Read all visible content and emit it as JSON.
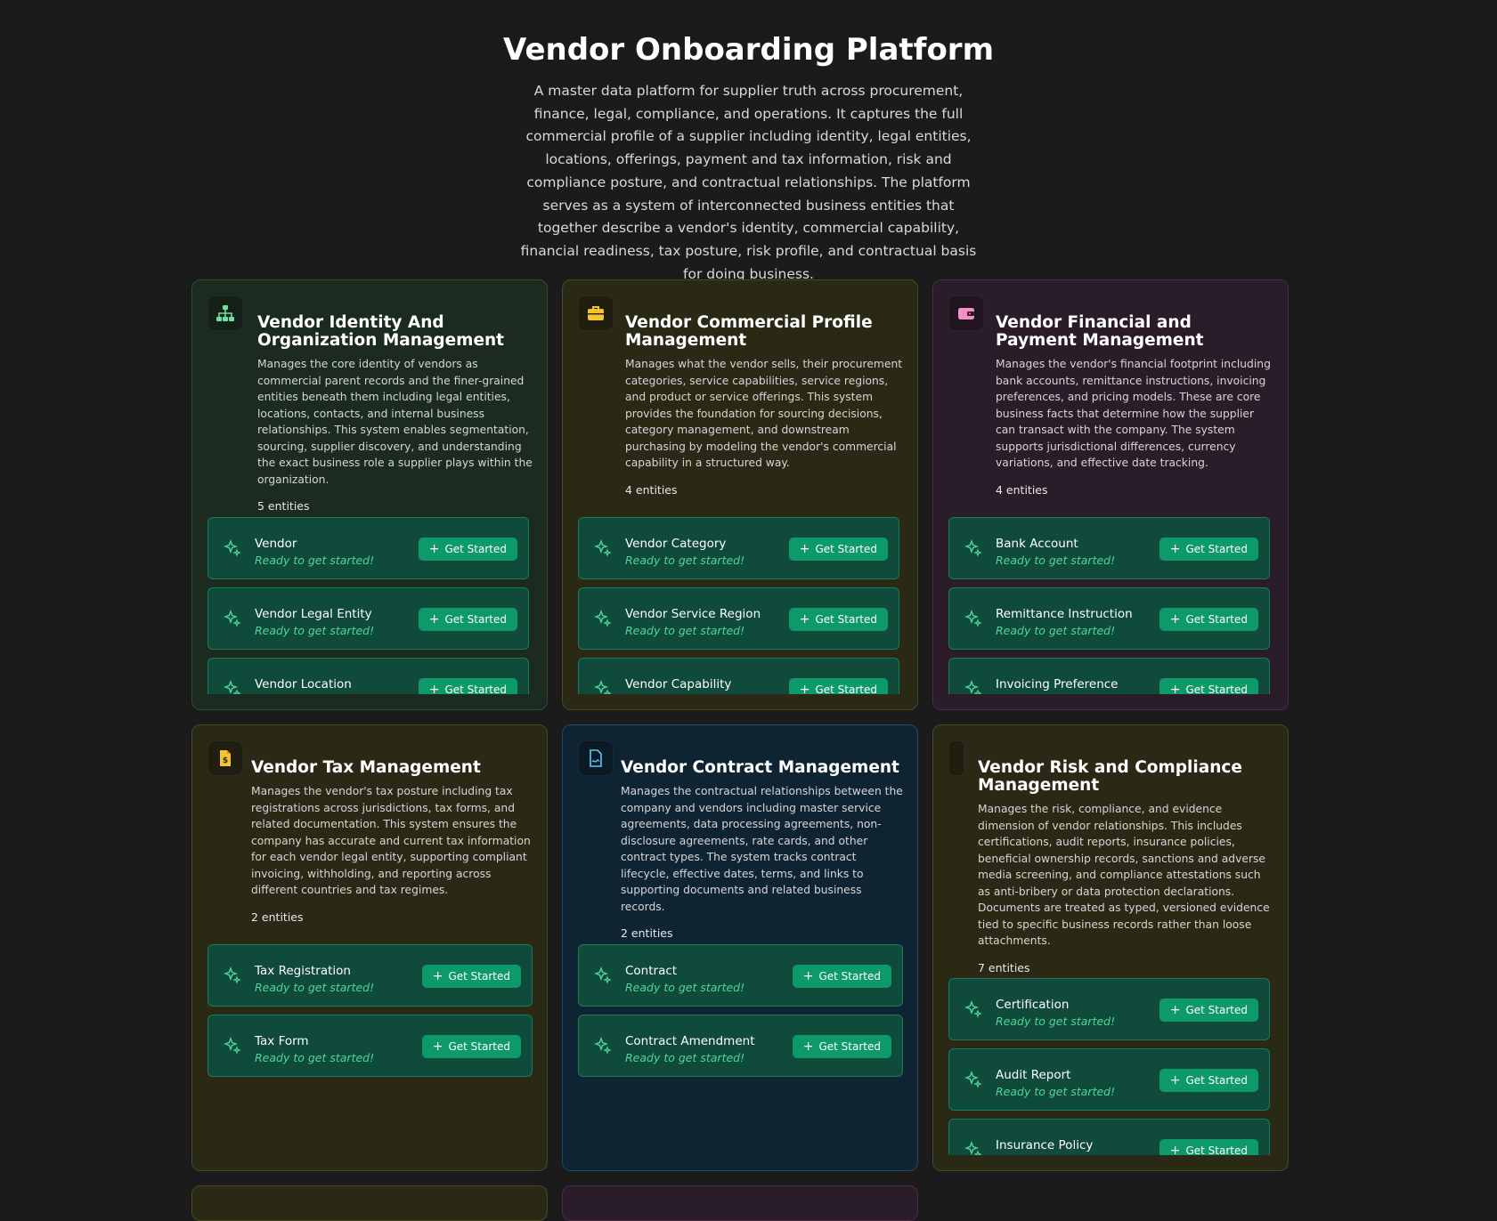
{
  "header": {
    "title": "Vendor Onboarding Platform",
    "description": "A master data platform for supplier truth across procurement, finance, legal, compliance, and operations. It captures the full commercial profile of a supplier including identity, legal entities, locations, offerings, payment and tax information, risk and compliance posture, and contractual relationships. The platform serves as a system of interconnected business entities that together describe a vendor's identity, commercial capability, financial readiness, tax posture, risk profile, and contractual basis for doing business."
  },
  "entity_status": "Ready to get started!",
  "button_label": "Get Started",
  "cards": [
    {
      "title": "Vendor Identity And Organization Management",
      "description": "Manages the core identity of vendors as commercial parent records and the finer-grained entities beneath them including legal entities, locations, contacts, and internal business relationships. This system enables segmentation, sourcing, supplier discovery, and understanding the exact business role a supplier plays within the organization.",
      "count": "5 entities",
      "icon": "org-chart-icon",
      "accent": "#6fe0a0",
      "entities": [
        "Vendor",
        "Vendor Legal Entity",
        "Vendor Location"
      ]
    },
    {
      "title": "Vendor Commercial Profile Management",
      "description": "Manages what the vendor sells, their procurement categories, service capabilities, service regions, and product or service offerings. This system provides the foundation for sourcing decisions, category management, and downstream purchasing by modeling the vendor's commercial capability in a structured way.",
      "count": "4 entities",
      "icon": "briefcase-icon",
      "accent": "#f5c531",
      "entities": [
        "Vendor Category",
        "Vendor Service Region",
        "Vendor Capability"
      ]
    },
    {
      "title": "Vendor Financial and Payment Management",
      "description": "Manages the vendor's financial footprint including bank accounts, remittance instructions, invoicing preferences, and pricing models. These are core business facts that determine how the supplier can transact with the company. The system supports jurisdictional differences, currency variations, and effective date tracking.",
      "count": "4 entities",
      "icon": "wallet-icon",
      "accent": "#f48fc8",
      "entities": [
        "Bank Account",
        "Remittance Instruction",
        "Invoicing Preference"
      ]
    },
    {
      "title": "Vendor Tax Management",
      "description": "Manages the vendor's tax posture including tax registrations across jurisdictions, tax forms, and related documentation. This system ensures the company has accurate and current tax information for each vendor legal entity, supporting compliant invoicing, withholding, and reporting across different countries and tax regimes.",
      "count": "2 entities",
      "icon": "tax-document-icon",
      "accent": "#f5c531",
      "entities": [
        "Tax Registration",
        "Tax Form"
      ]
    },
    {
      "title": "Vendor Contract Management",
      "description": "Manages the contractual relationships between the company and vendors including master service agreements, data processing agreements, non-disclosure agreements, rate cards, and other contract types. The system tracks contract lifecycle, effective dates, terms, and links to supporting documents and related business records.",
      "count": "2 entities",
      "icon": "contract-icon",
      "accent": "#5cc8f5",
      "entities": [
        "Contract",
        "Contract Amendment"
      ]
    },
    {
      "title": "Vendor Risk and Compliance Management",
      "description": "Manages the risk, compliance, and evidence dimension of vendor relationships. This includes certifications, audit reports, insurance policies, beneficial ownership records, sanctions and adverse media screening, and compliance attestations such as anti-bribery or data protection declarations. Documents are treated as typed, versioned evidence tied to specific business records rather than loose attachments.",
      "count": "7 entities",
      "icon": "shield-icon",
      "accent": "#f5c531",
      "entities": [
        "Certification",
        "Audit Report",
        "Insurance Policy"
      ]
    }
  ]
}
